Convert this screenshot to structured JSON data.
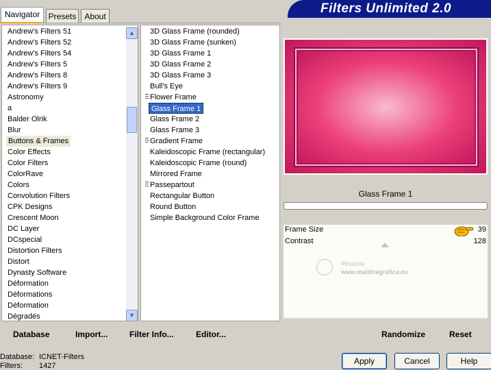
{
  "tabs": [
    "Navigator",
    "Presets",
    "About"
  ],
  "banner_title": "Filters Unlimited 2.0",
  "categories": [
    {
      "label": "Andrew's Filters 51"
    },
    {
      "label": "Andrew's Filters 52"
    },
    {
      "label": "Andrew's Filters 54"
    },
    {
      "label": "Andrew's Filters 5"
    },
    {
      "label": "Andrew's Filters 8"
    },
    {
      "label": "Andrew's Filters 9"
    },
    {
      "label": "Astronomy"
    },
    {
      "label": "a"
    },
    {
      "label": "Balder Olrik"
    },
    {
      "label": "Blur"
    },
    {
      "label": "Buttons & Frames",
      "selected": true
    },
    {
      "label": "Color Effects"
    },
    {
      "label": "Color Filters"
    },
    {
      "label": "ColorRave"
    },
    {
      "label": "Colors"
    },
    {
      "label": "Convolution Filters"
    },
    {
      "label": "CPK Designs"
    },
    {
      "label": "Crescent Moon"
    },
    {
      "label": "DC Layer"
    },
    {
      "label": "DCspecial"
    },
    {
      "label": "Distortion Filters"
    },
    {
      "label": "Distort"
    },
    {
      "label": "Dynasty Software"
    },
    {
      "label": "Déformation"
    },
    {
      "label": "Déformations"
    },
    {
      "label": "Déformation"
    },
    {
      "label": "Dégradés"
    }
  ],
  "filters": [
    {
      "label": "3D Glass Frame (rounded)"
    },
    {
      "label": "3D Glass Frame (sunken)"
    },
    {
      "label": "3D Glass Frame 1"
    },
    {
      "label": "3D Glass Frame 2"
    },
    {
      "label": "3D Glass Frame 3"
    },
    {
      "label": "Bull's Eye"
    },
    {
      "label": "Flower Frame",
      "grip": true
    },
    {
      "label": "Glass Frame 1",
      "selected": true
    },
    {
      "label": "Glass Frame 2"
    },
    {
      "label": "Glass Frame 3"
    },
    {
      "label": "Gradient Frame",
      "grip": true
    },
    {
      "label": "Kaleidoscopic Frame (rectangular)"
    },
    {
      "label": "Kaleidoscopic Frame (round)"
    },
    {
      "label": "Mirrored Frame"
    },
    {
      "label": "Passepartout",
      "grip": true
    },
    {
      "label": "Rectangular Button"
    },
    {
      "label": "Round Button"
    },
    {
      "label": "Simple Background Color Frame"
    }
  ],
  "filter_name": "Glass Frame 1",
  "sliders": [
    {
      "label": "Frame Size",
      "value": "39"
    },
    {
      "label": "Contrast",
      "value": "128"
    }
  ],
  "watermark": {
    "name": "Pinuccia",
    "url": "www.maldiregrafica.eu"
  },
  "bottom_buttons": {
    "database": "Database",
    "import": "Import...",
    "filter_info": "Filter Info...",
    "editor": "Editor...",
    "randomize": "Randomize",
    "reset": "Reset"
  },
  "status": {
    "database_label": "Database:",
    "database_value": "ICNET-Filters",
    "filters_label": "Filters:",
    "filters_value": "1427"
  },
  "window_buttons": {
    "apply": "Apply",
    "cancel": "Cancel",
    "help": "Help"
  },
  "colors": {
    "banner": "#0d1a8a",
    "frame": "#d81b60",
    "selection": "#316ac5"
  }
}
